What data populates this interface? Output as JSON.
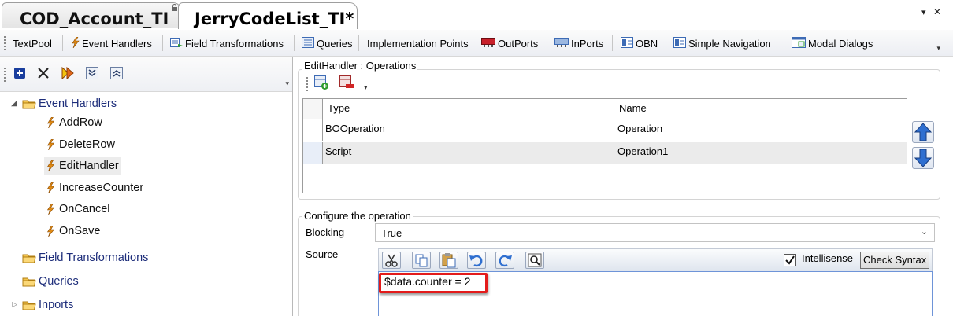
{
  "doc_tabs": [
    {
      "label": "COD_Account_TI",
      "active": false
    },
    {
      "label": "JerryCodeList_TI*",
      "active": true
    }
  ],
  "doc_controls": {
    "dropdown_icon": "triangle-down-icon",
    "close_icon": "close-icon"
  },
  "main_toolbar": {
    "items": [
      {
        "label": "TextPool",
        "icon": ""
      },
      {
        "label": "Event Handlers",
        "icon": "lightning-icon"
      },
      {
        "label": "Field Transformations",
        "icon": "field-transformations-icon"
      },
      {
        "label": "Queries",
        "icon": "queries-icon"
      },
      {
        "label": "Implementation Points",
        "icon": ""
      },
      {
        "label": "OutPorts",
        "icon": "outports-icon"
      },
      {
        "label": "InPorts",
        "icon": "inports-icon"
      },
      {
        "label": "OBN",
        "icon": "obn-icon"
      },
      {
        "label": "Simple Navigation",
        "icon": "simple-navigation-icon"
      },
      {
        "label": "Modal Dialogs",
        "icon": "modal-dialogs-icon"
      }
    ]
  },
  "left_toolbar": {
    "buttons": [
      "add-icon",
      "delete-icon",
      "run-icon",
      "expand-all-icon",
      "collapse-all-icon"
    ]
  },
  "tree": {
    "event_handlers": {
      "label": "Event Handlers",
      "expanded": true,
      "children": [
        "AddRow",
        "DeleteRow",
        "EditHandler",
        "IncreaseCounter",
        "OnCancel",
        "OnSave"
      ],
      "selected": "EditHandler"
    },
    "field_transformations": {
      "label": "Field Transformations"
    },
    "queries": {
      "label": "Queries"
    },
    "inports": {
      "label": "Inports"
    }
  },
  "operations_group": {
    "title": "EditHandler : Operations",
    "columns": [
      "Type",
      "Name"
    ],
    "rows": [
      {
        "type": "BOOperation",
        "name": "Operation"
      },
      {
        "type": "Script",
        "name": "Operation1"
      }
    ]
  },
  "configure_group": {
    "title": "Configure the operation",
    "blocking_label": "Blocking",
    "blocking_value": "True",
    "source_label": "Source",
    "intellisense_label": "Intellisense",
    "intellisense_checked": true,
    "check_syntax_label": "Check Syntax",
    "source_code": "$data.counter = 2"
  },
  "colors": {
    "folder_label": "#1d2d7a",
    "highlight_border": "#e31b1b",
    "editor_border": "#6e94d8",
    "arrow_blue": "#2f6fd0"
  }
}
